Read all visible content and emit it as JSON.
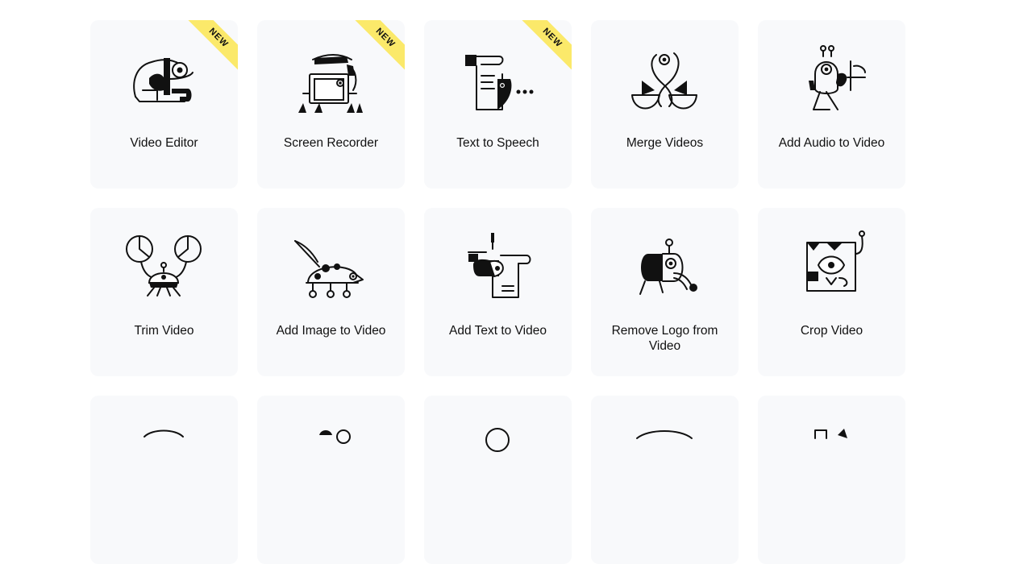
{
  "colors": {
    "card_bg": "#f8f9fb",
    "badge_bg": "#fbe96a",
    "text": "#111111"
  },
  "tools": [
    {
      "label": "Video Editor",
      "badge": "NEW",
      "icon": "chameleon-illustration-icon"
    },
    {
      "label": "Screen Recorder",
      "badge": "NEW",
      "icon": "screen-creature-illustration-icon"
    },
    {
      "label": "Text to Speech",
      "badge": "NEW",
      "icon": "scroll-bird-illustration-icon"
    },
    {
      "label": "Merge Videos",
      "badge": "",
      "icon": "twin-birds-illustration-icon"
    },
    {
      "label": "Add Audio to Video",
      "badge": "",
      "icon": "musician-creature-illustration-icon"
    },
    {
      "label": "Trim Video",
      "badge": "",
      "icon": "crab-illustration-icon"
    },
    {
      "label": "Add Image to Video",
      "badge": "",
      "icon": "brush-bug-illustration-icon"
    },
    {
      "label": "Add Text to Video",
      "badge": "",
      "icon": "text-scroll-creature-illustration-icon"
    },
    {
      "label": "Remove Logo from Video",
      "badge": "",
      "icon": "pill-creature-illustration-icon"
    },
    {
      "label": "Crop Video",
      "badge": "",
      "icon": "square-face-illustration-icon"
    },
    {
      "label": "",
      "badge": "",
      "icon": "partial-illustration-icon"
    },
    {
      "label": "",
      "badge": "",
      "icon": "partial-illustration-icon"
    },
    {
      "label": "",
      "badge": "",
      "icon": "partial-illustration-icon"
    },
    {
      "label": "",
      "badge": "",
      "icon": "partial-illustration-icon"
    },
    {
      "label": "",
      "badge": "",
      "icon": "partial-illustration-icon"
    }
  ]
}
